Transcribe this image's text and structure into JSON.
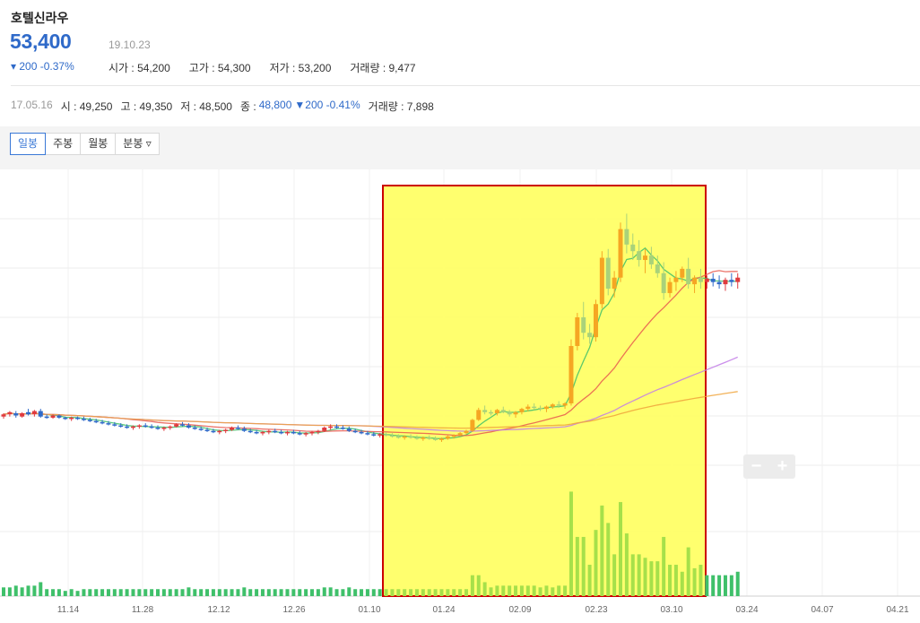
{
  "stock": {
    "name": "호텔신라우",
    "price": "53,400",
    "date": "19.10.23",
    "change": "▾ 200 -0.37%",
    "open": "시가 : 54,200",
    "high": "고가 : 54,300",
    "low": "저가 : 53,200",
    "volume": "거래량 : 9,477"
  },
  "hover": {
    "date": "17.05.16",
    "open": "시 : 49,250",
    "high": "고 : 49,350",
    "low": "저 : 48,500",
    "close_label": "종 :",
    "close_value": "48,800",
    "change": "▼200 -0.41%",
    "volume": "거래량 : 7,898"
  },
  "tabs": [
    "일봉",
    "주봉",
    "월봉",
    "분봉 ▿"
  ],
  "zoom": {
    "minus": "−",
    "plus": "+"
  },
  "colors": {
    "up": "#e03a3e",
    "down": "#2f6ac9",
    "volume": "#3fc06a",
    "ma5": "#3fc06a",
    "ma20": "#e85a4f",
    "ma60": "#c27be8",
    "ma120": "#f0a53c",
    "highlight": "#ffff66",
    "highlight_border": "#cc0000"
  },
  "chart_data": {
    "type": "candlestick",
    "x_ticks": [
      "11.14",
      "11.28",
      "12.12",
      "12.26",
      "01.10",
      "01.24",
      "02.09",
      "02.23",
      "03.10",
      "03.24",
      "04.07",
      "04.21"
    ],
    "price_range": [
      47200,
      59800
    ],
    "candles": [
      [
        49000,
        49150,
        48900,
        49100
      ],
      [
        49100,
        49250,
        49000,
        49200
      ],
      [
        49150,
        49250,
        48950,
        49050
      ],
      [
        49000,
        49200,
        48950,
        49150
      ],
      [
        49200,
        49350,
        49050,
        49100
      ],
      [
        49100,
        49300,
        49000,
        49250
      ],
      [
        49250,
        49350,
        48950,
        49000
      ],
      [
        49000,
        49100,
        48900,
        48950
      ],
      [
        48950,
        49100,
        48900,
        49050
      ],
      [
        49050,
        49100,
        48900,
        48950
      ],
      [
        48950,
        49000,
        48850,
        48900
      ],
      [
        48900,
        49000,
        48800,
        48950
      ],
      [
        48950,
        49000,
        48850,
        48900
      ],
      [
        48900,
        49000,
        48800,
        48850
      ],
      [
        48850,
        48950,
        48750,
        48800
      ],
      [
        48800,
        48900,
        48700,
        48750
      ],
      [
        48750,
        48850,
        48650,
        48700
      ],
      [
        48700,
        48800,
        48600,
        48650
      ],
      [
        48650,
        48750,
        48550,
        48600
      ],
      [
        48600,
        48700,
        48500,
        48550
      ],
      [
        48550,
        48650,
        48450,
        48500
      ],
      [
        48500,
        48600,
        48400,
        48550
      ],
      [
        48550,
        48650,
        48450,
        48600
      ],
      [
        48600,
        48700,
        48500,
        48550
      ],
      [
        48550,
        48650,
        48450,
        48500
      ],
      [
        48500,
        48600,
        48400,
        48450
      ],
      [
        48450,
        48550,
        48350,
        48500
      ],
      [
        48500,
        48600,
        48400,
        48550
      ],
      [
        48550,
        48700,
        48500,
        48650
      ],
      [
        48650,
        48750,
        48550,
        48600
      ],
      [
        48600,
        48700,
        48450,
        48500
      ],
      [
        48500,
        48600,
        48400,
        48450
      ],
      [
        48450,
        48550,
        48350,
        48400
      ],
      [
        48400,
        48500,
        48300,
        48350
      ],
      [
        48350,
        48450,
        48250,
        48300
      ],
      [
        48300,
        48400,
        48200,
        48350
      ],
      [
        48350,
        48450,
        48250,
        48400
      ],
      [
        48400,
        48550,
        48350,
        48500
      ],
      [
        48500,
        48600,
        48400,
        48450
      ],
      [
        48450,
        48550,
        48300,
        48350
      ],
      [
        48350,
        48450,
        48250,
        48300
      ],
      [
        48300,
        48400,
        48200,
        48250
      ],
      [
        48250,
        48350,
        48150,
        48300
      ],
      [
        48300,
        48400,
        48200,
        48350
      ],
      [
        48350,
        48450,
        48250,
        48300
      ],
      [
        48300,
        48400,
        48200,
        48250
      ],
      [
        48250,
        48350,
        48150,
        48300
      ],
      [
        48300,
        48400,
        48200,
        48250
      ],
      [
        48250,
        48350,
        48150,
        48200
      ],
      [
        48200,
        48300,
        48100,
        48250
      ],
      [
        48250,
        48350,
        48150,
        48300
      ],
      [
        48300,
        48400,
        48200,
        48350
      ],
      [
        48350,
        48550,
        48300,
        48500
      ],
      [
        48500,
        48650,
        48400,
        48550
      ],
      [
        48550,
        48650,
        48450,
        48500
      ],
      [
        48500,
        48600,
        48400,
        48450
      ],
      [
        48450,
        48550,
        48300,
        48350
      ],
      [
        48350,
        48450,
        48250,
        48300
      ],
      [
        48300,
        48400,
        48200,
        48250
      ],
      [
        48250,
        48350,
        48150,
        48200
      ],
      [
        48200,
        48300,
        48100,
        48150
      ],
      [
        48150,
        48250,
        48050,
        48200
      ],
      [
        48200,
        48300,
        48100,
        48150
      ],
      [
        48150,
        48250,
        48050,
        48100
      ],
      [
        48100,
        48200,
        48000,
        48050
      ],
      [
        48050,
        48150,
        47950,
        48100
      ],
      [
        48100,
        48200,
        48000,
        48050
      ],
      [
        48050,
        48150,
        47950,
        48000
      ],
      [
        48000,
        48100,
        47900,
        48050
      ],
      [
        48050,
        48150,
        47950,
        48000
      ],
      [
        48000,
        48100,
        47900,
        47950
      ],
      [
        47950,
        48050,
        47850,
        48000
      ],
      [
        48000,
        48150,
        47950,
        48100
      ],
      [
        48100,
        48200,
        48000,
        48150
      ],
      [
        48150,
        48300,
        48100,
        48250
      ],
      [
        48250,
        48400,
        48200,
        48350
      ],
      [
        48350,
        48900,
        48300,
        48850
      ],
      [
        48850,
        49400,
        48800,
        49300
      ],
      [
        49300,
        49500,
        49100,
        49200
      ],
      [
        49200,
        49300,
        49050,
        49150
      ],
      [
        49150,
        49350,
        49050,
        49300
      ],
      [
        49300,
        49450,
        49150,
        49200
      ],
      [
        49200,
        49300,
        49000,
        49100
      ],
      [
        49100,
        49250,
        48950,
        49200
      ],
      [
        49200,
        49400,
        49100,
        49350
      ],
      [
        49350,
        49550,
        49250,
        49450
      ],
      [
        49450,
        49600,
        49300,
        49400
      ],
      [
        49400,
        49500,
        49250,
        49350
      ],
      [
        49350,
        49500,
        49200,
        49450
      ],
      [
        49450,
        49600,
        49350,
        49550
      ],
      [
        49550,
        49700,
        49400,
        49500
      ],
      [
        49500,
        49650,
        49350,
        49600
      ],
      [
        49600,
        52500,
        49500,
        52200
      ],
      [
        52200,
        53700,
        52000,
        53500
      ],
      [
        53500,
        54200,
        52500,
        52800
      ],
      [
        52800,
        53200,
        52300,
        52600
      ],
      [
        52600,
        54300,
        52400,
        54100
      ],
      [
        54100,
        56500,
        53900,
        56200
      ],
      [
        56200,
        56600,
        54500,
        54800
      ],
      [
        54800,
        55600,
        54400,
        55300
      ],
      [
        55300,
        57800,
        55100,
        57500
      ],
      [
        57500,
        58200,
        56400,
        56800
      ],
      [
        56800,
        57300,
        56100,
        56500
      ],
      [
        56500,
        57000,
        55800,
        56100
      ],
      [
        56100,
        56600,
        55500,
        56300
      ],
      [
        56300,
        56700,
        55700,
        55900
      ],
      [
        55900,
        56300,
        55300,
        55500
      ],
      [
        55500,
        56000,
        54300,
        54600
      ],
      [
        54600,
        55300,
        54400,
        55100
      ],
      [
        55100,
        55600,
        54700,
        55300
      ],
      [
        55300,
        55800,
        55100,
        55700
      ],
      [
        55700,
        56200,
        54800,
        55000
      ],
      [
        55000,
        55400,
        54600,
        55300
      ],
      [
        55300,
        55700,
        54800,
        55100
      ],
      [
        55100,
        55400,
        54800,
        55250
      ],
      [
        55250,
        55500,
        54900,
        55100
      ],
      [
        55100,
        55400,
        54800,
        55000
      ],
      [
        55000,
        55300,
        54700,
        55200
      ],
      [
        55200,
        55500,
        54900,
        55100
      ],
      [
        55100,
        55500,
        54800,
        55300
      ]
    ],
    "volume_range": [
      0,
      100
    ]
  }
}
